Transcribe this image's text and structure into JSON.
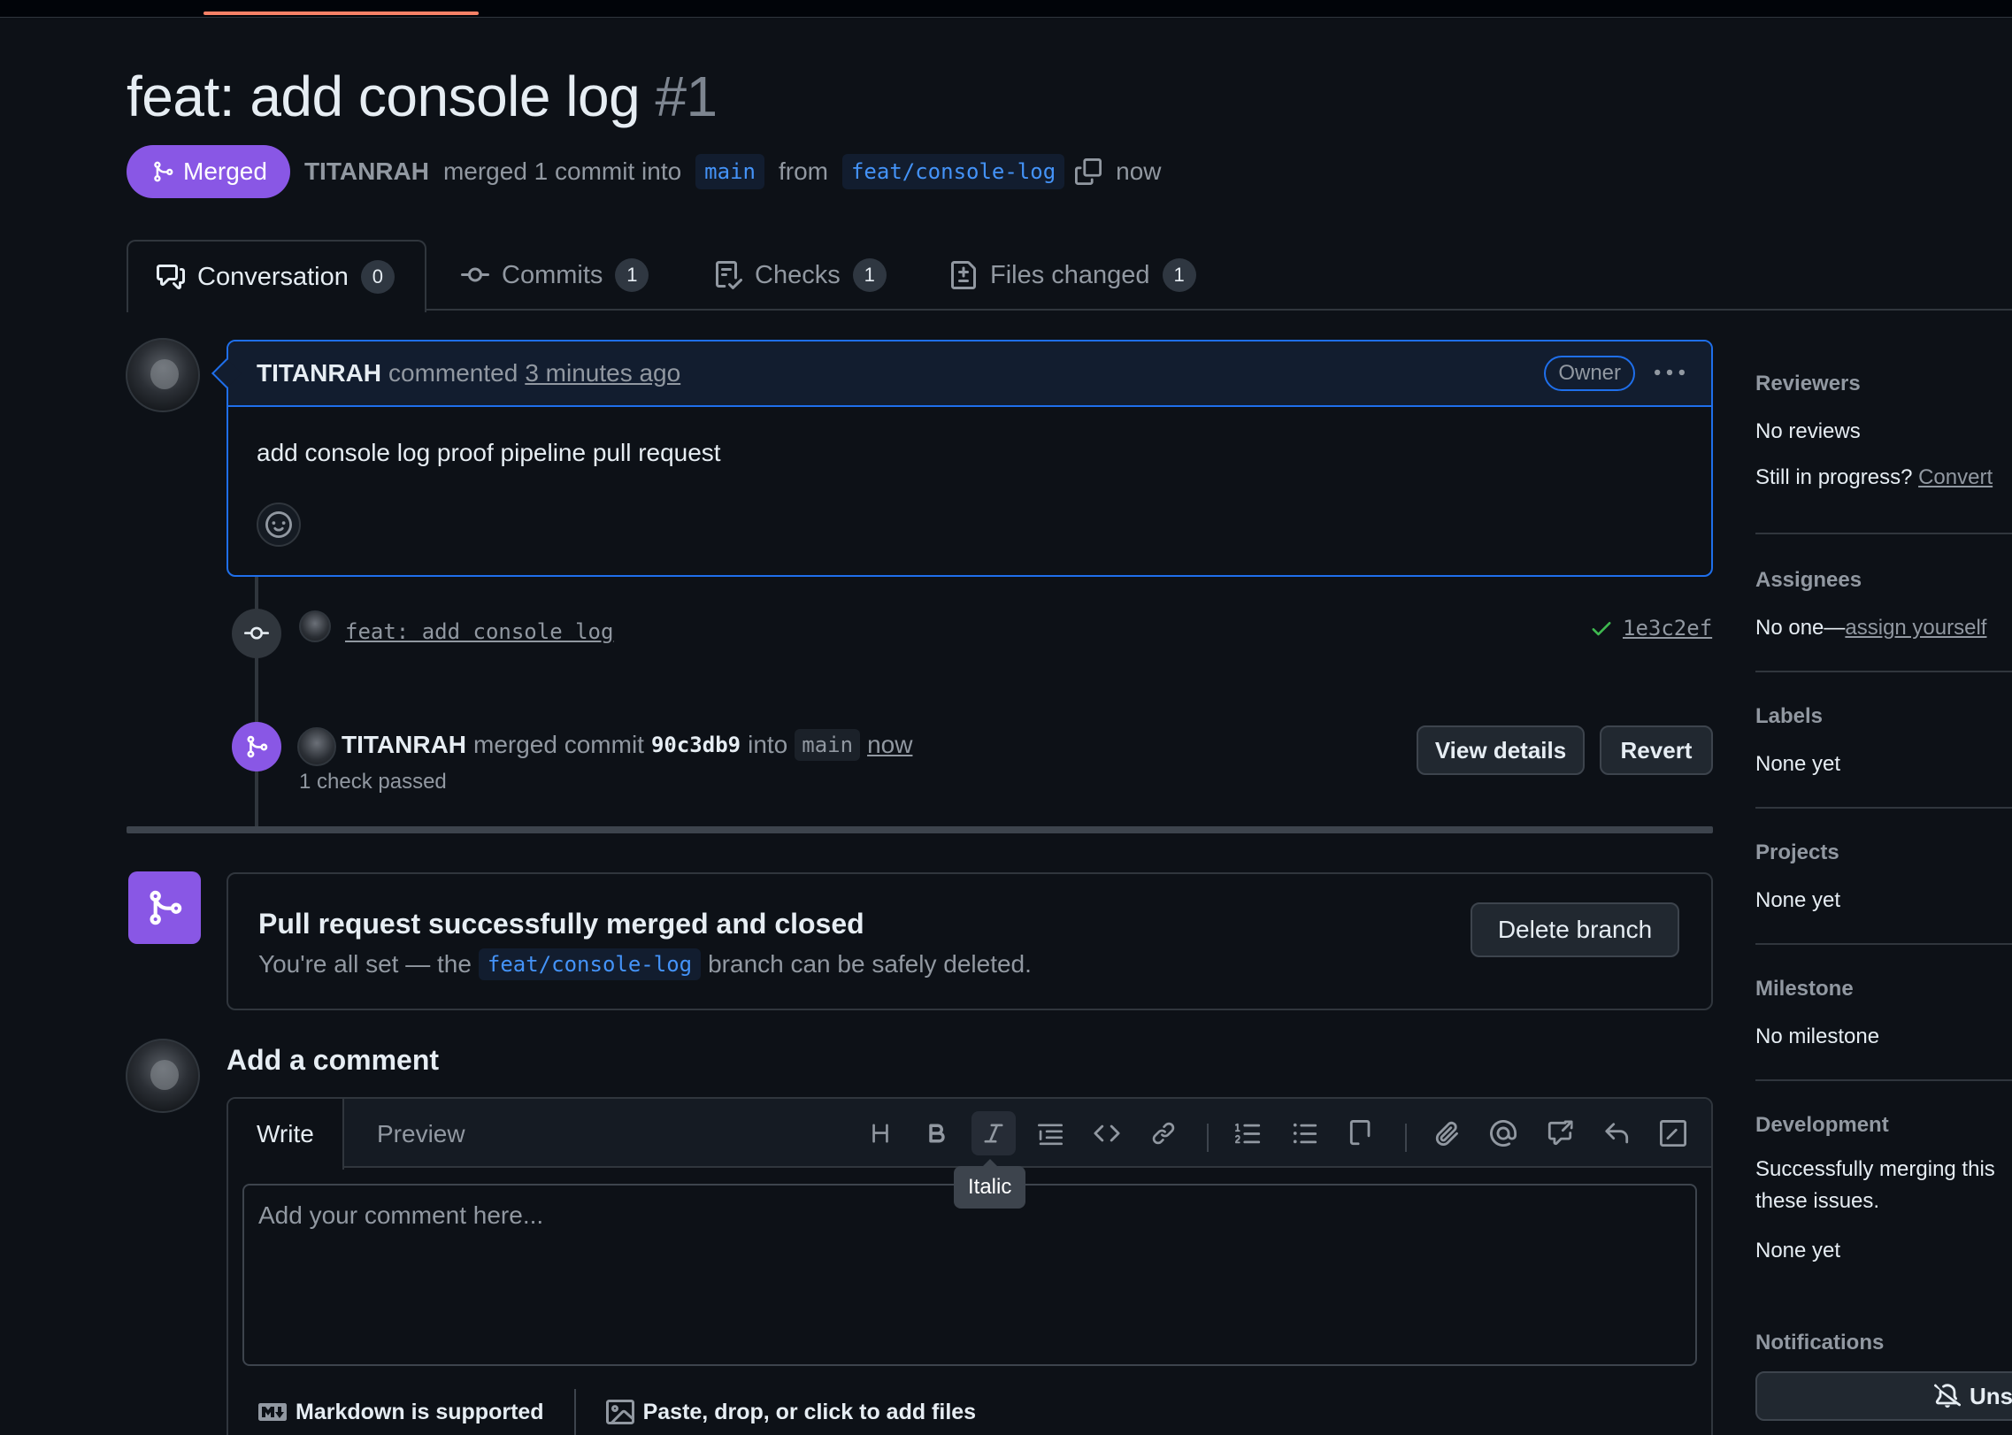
{
  "pr": {
    "title": "feat: add console log",
    "number": "#1",
    "state": "Merged",
    "author": "TITANRAH",
    "merge_text": "merged 1 commit into",
    "base_branch": "main",
    "from_text": "from",
    "head_branch": "feat/console-log",
    "time": "now"
  },
  "tabs": [
    {
      "label": "Conversation",
      "count": "0",
      "icon": "conversation-icon"
    },
    {
      "label": "Commits",
      "count": "1",
      "icon": "git-commit-icon"
    },
    {
      "label": "Checks",
      "count": "1",
      "icon": "checklist-icon"
    },
    {
      "label": "Files changed",
      "count": "1",
      "icon": "file-diff-icon"
    }
  ],
  "comment": {
    "author": "TITANRAH",
    "action": "commented",
    "time": "3 minutes ago",
    "badge": "Owner",
    "body": "add console log proof pipeline pull request"
  },
  "commit": {
    "message": "feat: add console log",
    "sha": "1e3c2ef"
  },
  "merge_event": {
    "author": "TITANRAH",
    "text": "merged commit",
    "sha": "90c3db9",
    "into": "into",
    "branch": "main",
    "time": "now",
    "checks": "1 check passed",
    "view_details": "View details",
    "revert": "Revert"
  },
  "merged_box": {
    "title": "Pull request successfully merged and closed",
    "sub_prefix": "You're all set — the",
    "branch": "feat/console-log",
    "sub_suffix": "branch can be safely deleted.",
    "delete_button": "Delete branch"
  },
  "add_comment": {
    "title": "Add a comment",
    "tab_write": "Write",
    "tab_preview": "Preview",
    "placeholder": "Add your comment here...",
    "tooltip": "Italic",
    "markdown_note": "Markdown is supported",
    "attach_note": "Paste, drop, or click to add files"
  },
  "sidebar": {
    "reviewers": {
      "heading": "Reviewers",
      "value": "No reviews",
      "progress_prefix": "Still in progress?",
      "progress_link": "Convert"
    },
    "assignees": {
      "heading": "Assignees",
      "prefix": "No one—",
      "link": "assign yourself"
    },
    "labels": {
      "heading": "Labels",
      "value": "None yet"
    },
    "projects": {
      "heading": "Projects",
      "value": "None yet"
    },
    "milestone": {
      "heading": "Milestone",
      "value": "No milestone"
    },
    "development": {
      "heading": "Development",
      "line1": "Successfully merging this",
      "line2": "these issues.",
      "value": "None yet"
    },
    "notifications": {
      "heading": "Notifications",
      "button": "Uns"
    }
  },
  "colors": {
    "accent_merged": "#8957e5",
    "link_blue": "#4493f8",
    "check_green": "#3fb950"
  }
}
